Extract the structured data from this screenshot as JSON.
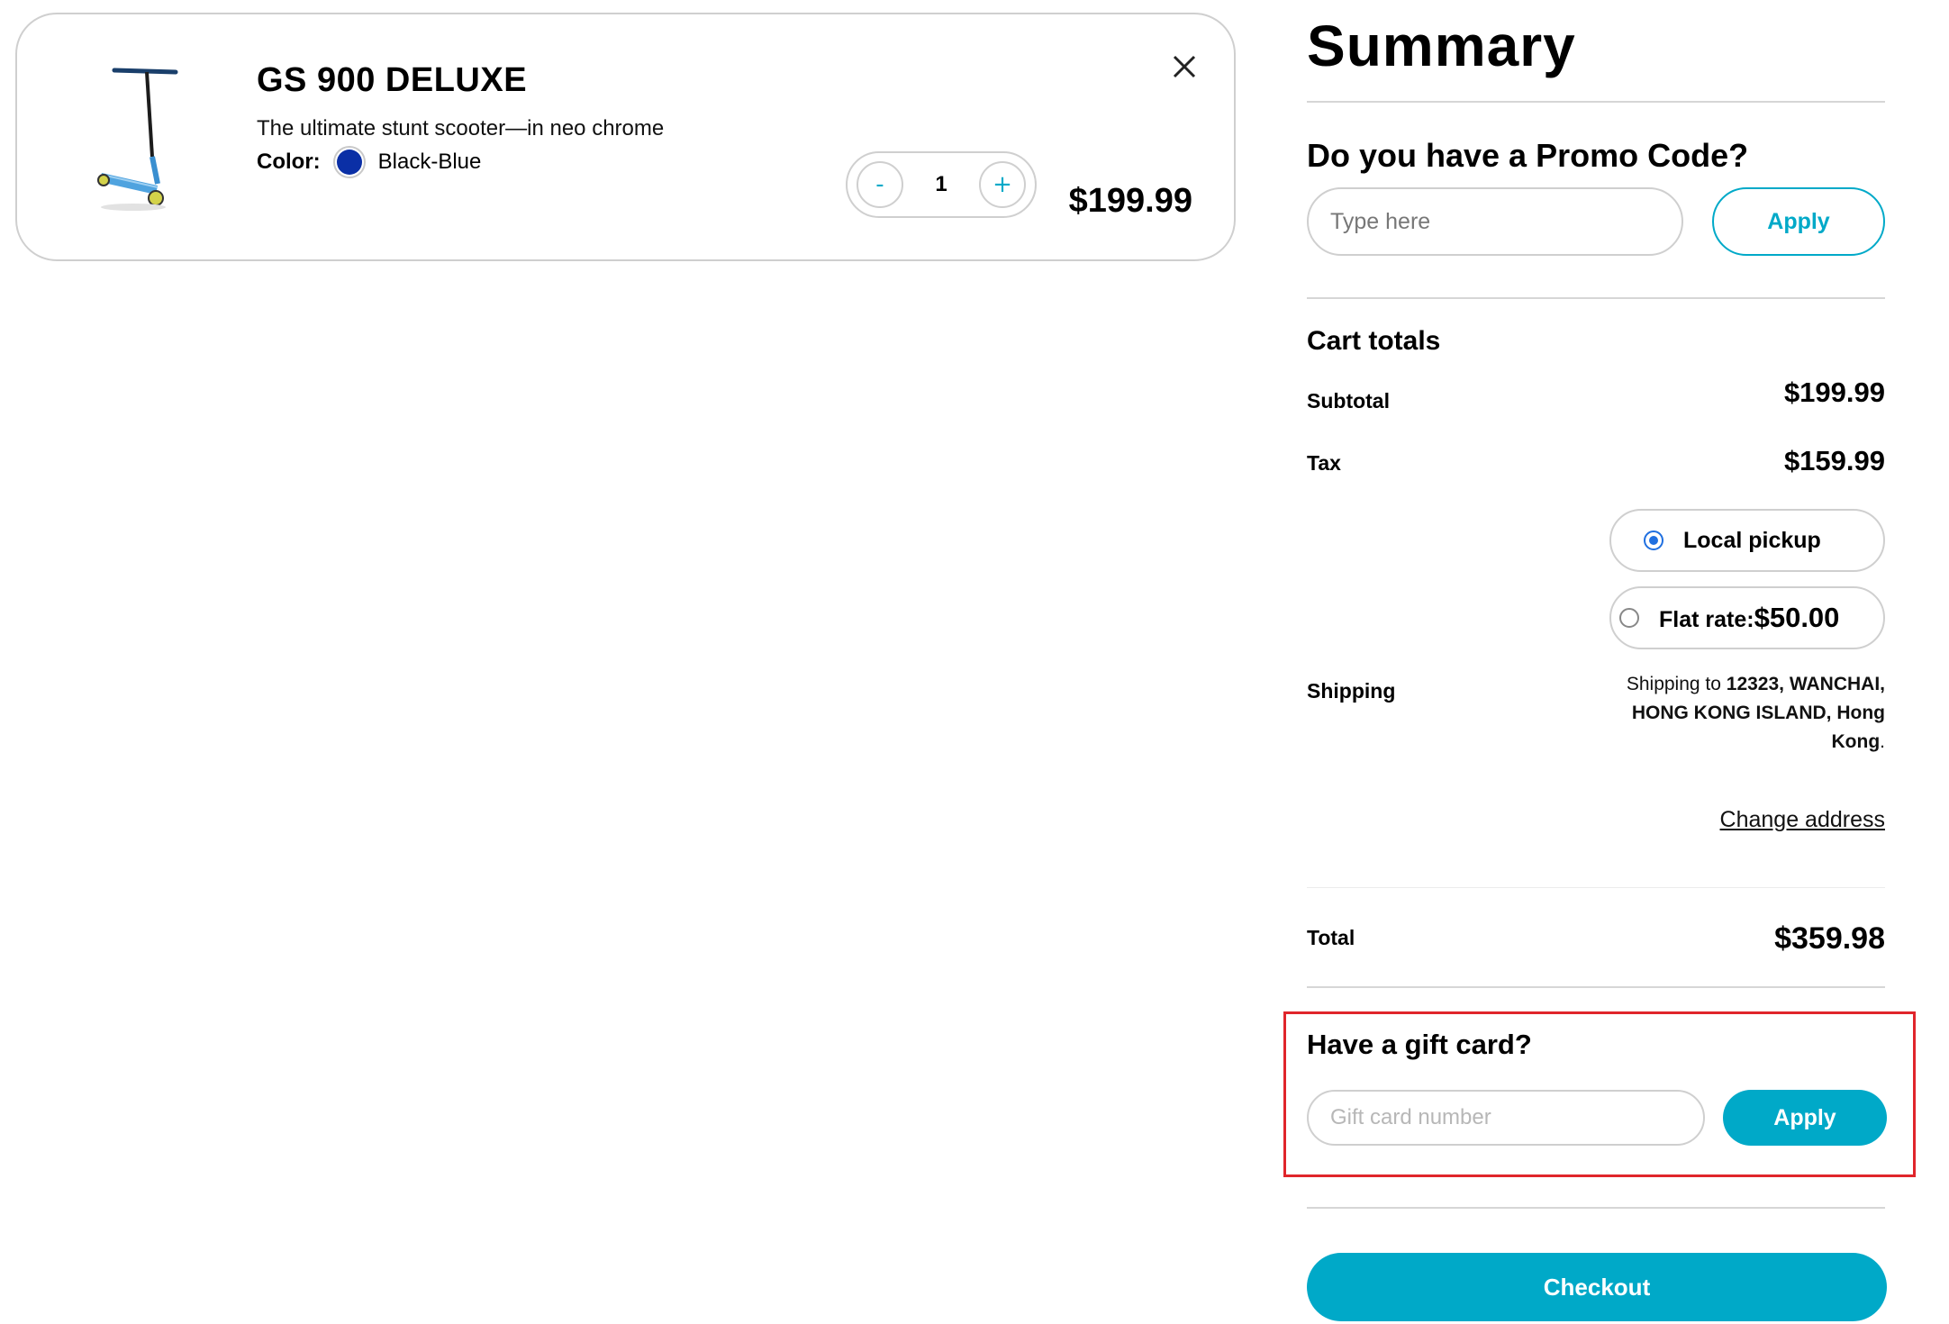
{
  "cart_item": {
    "name": "GS 900 DELUXE",
    "description": "The ultimate stunt scooter—in neo chrome",
    "color_label": "Color:",
    "color_name": "Black-Blue",
    "color_hex": "#0a2fa6",
    "quantity": "1",
    "decrement_label": "-",
    "increment_label": "+",
    "price": "$199.99",
    "image_icon": "scooter-image",
    "remove_icon": "close-icon"
  },
  "summary": {
    "title": "Summary",
    "promo": {
      "title": "Do you have a Promo Code?",
      "placeholder": "Type here",
      "apply_label": "Apply"
    },
    "cart_totals": {
      "title": "Cart totals",
      "subtotal_label": "Subtotal",
      "subtotal_value": "$199.99",
      "tax_label": "Tax",
      "tax_value": "$159.99",
      "shipping_label": "Shipping",
      "shipping_options": [
        {
          "label": "Local pickup",
          "price": "",
          "selected": true
        },
        {
          "label": "Flat rate:",
          "price": "$50.00",
          "selected": false
        }
      ],
      "shipping_to_prefix": "Shipping to ",
      "shipping_address": "12323, WANCHAI, HONG KONG ISLAND, Hong Kong",
      "shipping_to_suffix": ".",
      "change_address_label": "Change address",
      "total_label": "Total",
      "total_value": "$359.98"
    },
    "gift_card": {
      "title": "Have a gift card?",
      "placeholder": "Gift card number",
      "apply_label": "Apply"
    },
    "checkout_label": "Checkout"
  },
  "colors": {
    "accent": "#00a9c8",
    "highlight_border": "#e0252b",
    "radio_selected": "#1f6fe0"
  }
}
